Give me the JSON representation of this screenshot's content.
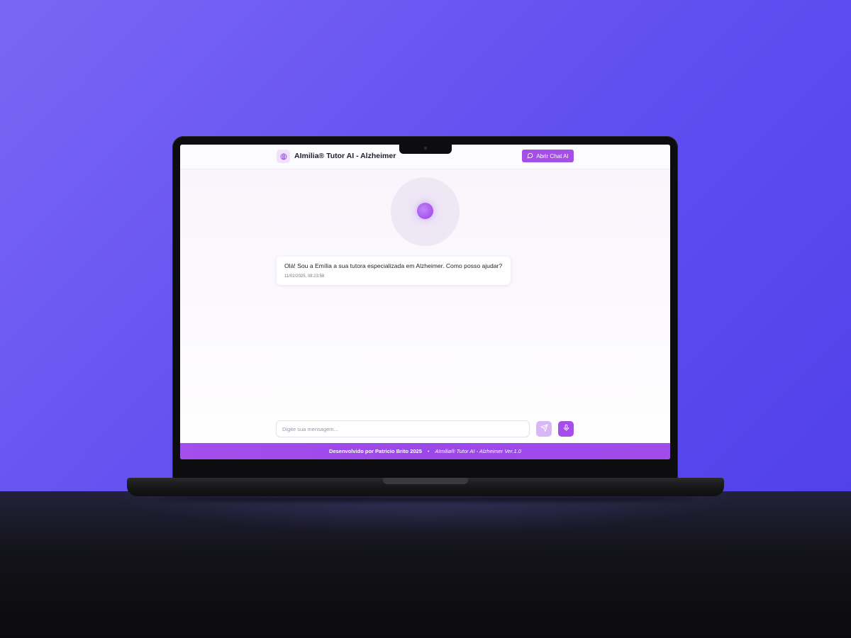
{
  "header": {
    "app_title": "AImilia® Tutor AI - Alzheimer",
    "brand_icon": "brain-icon",
    "open_chat_label": "Abrir Chat AI",
    "open_chat_icon": "message-circle-icon"
  },
  "chat": {
    "messages": [
      {
        "text": "Olá! Sou a Emília a sua tutora especializada em Alzheimer. Como posso ajudar?",
        "timestamp": "11/02/2025, 08:23:58"
      }
    ]
  },
  "composer": {
    "placeholder": "Digite sua mensagem...",
    "value": "",
    "send_icon": "send-icon",
    "mic_icon": "microphone-icon"
  },
  "footer": {
    "credit": "Desenvolvido por Patricio Brito 2025",
    "separator": "•",
    "version": "AImilia® Tutor AI - Alzheimer Ver.1.0"
  },
  "colors": {
    "accent": "#a54ee8",
    "accent_light": "#d9b7f5",
    "background_top": "#7b66f4",
    "background_bottom": "#4f3ee8"
  }
}
